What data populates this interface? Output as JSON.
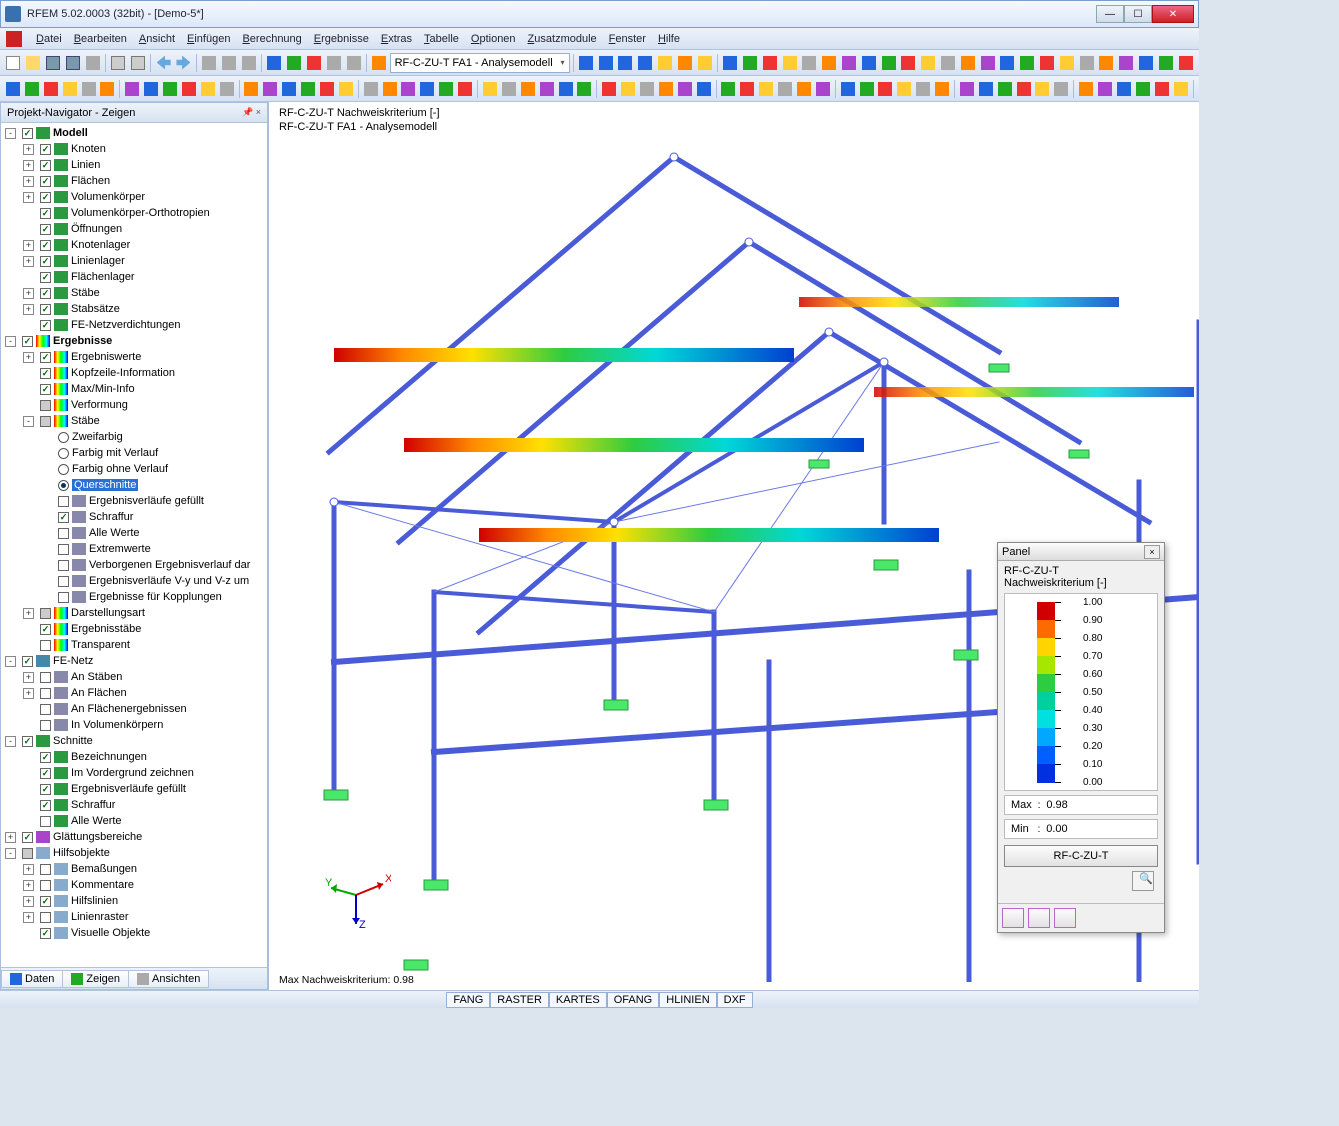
{
  "window": {
    "title": "RFEM 5.02.0003 (32bit) - [Demo-5*]"
  },
  "menu": [
    "Datei",
    "Bearbeiten",
    "Ansicht",
    "Einfügen",
    "Berechnung",
    "Ergebnisse",
    "Extras",
    "Tabelle",
    "Optionen",
    "Zusatzmodule",
    "Fenster",
    "Hilfe"
  ],
  "combo": "RF-C-ZU-T FA1 - Analysemodell",
  "navigator": {
    "title": "Projekt-Navigator - Zeigen",
    "tabs": [
      "Daten",
      "Zeigen",
      "Ansichten"
    ]
  },
  "tree": [
    {
      "d": 0,
      "exp": "-",
      "cb": true,
      "ico": 1,
      "lbl": "Modell",
      "bold": true
    },
    {
      "d": 1,
      "exp": "+",
      "cb": true,
      "ico": 1,
      "lbl": "Knoten"
    },
    {
      "d": 1,
      "exp": "+",
      "cb": true,
      "ico": 1,
      "lbl": "Linien"
    },
    {
      "d": 1,
      "exp": "+",
      "cb": true,
      "ico": 1,
      "lbl": "Flächen"
    },
    {
      "d": 1,
      "exp": "+",
      "cb": true,
      "ico": 1,
      "lbl": "Volumenkörper"
    },
    {
      "d": 1,
      "noexp": true,
      "cb": true,
      "ico": 1,
      "lbl": "Volumenkörper-Orthotropien"
    },
    {
      "d": 1,
      "noexp": true,
      "cb": true,
      "ico": 1,
      "lbl": "Öffnungen"
    },
    {
      "d": 1,
      "exp": "+",
      "cb": true,
      "ico": 1,
      "lbl": "Knotenlager"
    },
    {
      "d": 1,
      "exp": "+",
      "cb": true,
      "ico": 1,
      "lbl": "Linienlager"
    },
    {
      "d": 1,
      "noexp": true,
      "cb": true,
      "ico": 1,
      "lbl": "Flächenlager"
    },
    {
      "d": 1,
      "exp": "+",
      "cb": true,
      "ico": 1,
      "lbl": "Stäbe"
    },
    {
      "d": 1,
      "exp": "+",
      "cb": true,
      "ico": 1,
      "lbl": "Stabsätze"
    },
    {
      "d": 1,
      "noexp": true,
      "cb": true,
      "ico": 1,
      "lbl": "FE-Netzverdichtungen"
    },
    {
      "d": 0,
      "exp": "-",
      "cb": true,
      "ico": 2,
      "lbl": "Ergebnisse",
      "bold": true
    },
    {
      "d": 1,
      "exp": "+",
      "cb": true,
      "ico": 2,
      "lbl": "Ergebniswerte"
    },
    {
      "d": 1,
      "noexp": true,
      "cb": true,
      "ico": 2,
      "lbl": "Kopfzeile-Information"
    },
    {
      "d": 1,
      "noexp": true,
      "cb": true,
      "ico": 2,
      "lbl": "Max/Min-Info"
    },
    {
      "d": 1,
      "noexp": true,
      "cb": false,
      "mixed": true,
      "ico": 2,
      "lbl": "Verformung"
    },
    {
      "d": 1,
      "exp": "-",
      "cb": false,
      "mixed": true,
      "ico": 2,
      "lbl": "Stäbe"
    },
    {
      "d": 2,
      "noexp": true,
      "radio": false,
      "lbl": "Zweifarbig"
    },
    {
      "d": 2,
      "noexp": true,
      "radio": false,
      "lbl": "Farbig mit Verlauf"
    },
    {
      "d": 2,
      "noexp": true,
      "radio": false,
      "lbl": "Farbig ohne Verlauf"
    },
    {
      "d": 2,
      "noexp": true,
      "radio": true,
      "lbl": "Querschnitte",
      "sel": true
    },
    {
      "d": 2,
      "noexp": true,
      "cb": false,
      "ico": 3,
      "lbl": "Ergebnisverläufe gefüllt"
    },
    {
      "d": 2,
      "noexp": true,
      "cb": true,
      "ico": 3,
      "lbl": "Schraffur"
    },
    {
      "d": 2,
      "noexp": true,
      "cb": false,
      "ico": 3,
      "lbl": "Alle Werte"
    },
    {
      "d": 2,
      "noexp": true,
      "cb": false,
      "ico": 3,
      "lbl": "Extremwerte"
    },
    {
      "d": 2,
      "noexp": true,
      "cb": false,
      "ico": 3,
      "lbl": "Verborgenen Ergebnisverlauf dar"
    },
    {
      "d": 2,
      "noexp": true,
      "cb": false,
      "ico": 3,
      "lbl": "Ergebnisverläufe V-y und V-z um"
    },
    {
      "d": 2,
      "noexp": true,
      "cb": false,
      "ico": 3,
      "lbl": "Ergebnisse für Kopplungen"
    },
    {
      "d": 1,
      "exp": "+",
      "cb": false,
      "mixed": true,
      "ico": 2,
      "lbl": "Darstellungsart"
    },
    {
      "d": 1,
      "noexp": true,
      "cb": true,
      "ico": 2,
      "lbl": "Ergebnisstäbe"
    },
    {
      "d": 1,
      "noexp": true,
      "cb": false,
      "ico": 2,
      "lbl": "Transparent"
    },
    {
      "d": 0,
      "exp": "-",
      "cb": true,
      "ico": 4,
      "lbl": "FE-Netz"
    },
    {
      "d": 1,
      "exp": "+",
      "cb": false,
      "ico": 3,
      "lbl": "An Stäben"
    },
    {
      "d": 1,
      "exp": "+",
      "cb": false,
      "ico": 3,
      "lbl": "An Flächen"
    },
    {
      "d": 1,
      "noexp": true,
      "cb": false,
      "ico": 3,
      "lbl": "An Flächenergebnissen"
    },
    {
      "d": 1,
      "noexp": true,
      "cb": false,
      "ico": 3,
      "lbl": "In Volumenkörpern"
    },
    {
      "d": 0,
      "exp": "-",
      "cb": true,
      "ico": 1,
      "lbl": "Schnitte"
    },
    {
      "d": 1,
      "noexp": true,
      "cb": true,
      "ico": 1,
      "lbl": "Bezeichnungen"
    },
    {
      "d": 1,
      "noexp": true,
      "cb": true,
      "ico": 1,
      "lbl": "Im Vordergrund zeichnen"
    },
    {
      "d": 1,
      "noexp": true,
      "cb": true,
      "ico": 1,
      "lbl": "Ergebnisverläufe gefüllt"
    },
    {
      "d": 1,
      "noexp": true,
      "cb": true,
      "ico": 1,
      "lbl": "Schraffur"
    },
    {
      "d": 1,
      "noexp": true,
      "cb": false,
      "ico": 1,
      "lbl": "Alle Werte"
    },
    {
      "d": 0,
      "exp": "+",
      "cb": true,
      "ico": 5,
      "lbl": "Glättungsbereiche"
    },
    {
      "d": 0,
      "exp": "-",
      "cb": false,
      "mixed": true,
      "ico": 6,
      "lbl": "Hilfsobjekte"
    },
    {
      "d": 1,
      "exp": "+",
      "cb": false,
      "ico": 6,
      "lbl": "Bemaßungen"
    },
    {
      "d": 1,
      "exp": "+",
      "cb": false,
      "ico": 6,
      "lbl": "Kommentare"
    },
    {
      "d": 1,
      "exp": "+",
      "cb": true,
      "ico": 6,
      "lbl": "Hilfslinien"
    },
    {
      "d": 1,
      "exp": "+",
      "cb": false,
      "ico": 6,
      "lbl": "Linienraster"
    },
    {
      "d": 1,
      "noexp": true,
      "cb": true,
      "ico": 6,
      "lbl": "Visuelle Objekte"
    }
  ],
  "canvas": {
    "line1": "RF-C-ZU-T Nachweiskriterium [-]",
    "line2": "RF-C-ZU-T FA1 - Analysemodell",
    "footer": "Max Nachweiskriterium: 0.98",
    "axes": [
      "X",
      "Y",
      "Z"
    ]
  },
  "panel": {
    "title": "Panel",
    "sub1": "RF-C-ZU-T",
    "sub2": "Nachweiskriterium [-]",
    "legend": [
      {
        "v": "1.00",
        "c": "#d00000"
      },
      {
        "v": "0.90",
        "c": "#ff6a00"
      },
      {
        "v": "0.80",
        "c": "#ffd400"
      },
      {
        "v": "0.70",
        "c": "#a6e600"
      },
      {
        "v": "0.60",
        "c": "#2ecc40"
      },
      {
        "v": "0.50",
        "c": "#00d0a0"
      },
      {
        "v": "0.40",
        "c": "#00e0e0"
      },
      {
        "v": "0.30",
        "c": "#00a8ff"
      },
      {
        "v": "0.20",
        "c": "#0060ff"
      },
      {
        "v": "0.10",
        "c": "#0030e0"
      },
      {
        "v": "0.00",
        "c": "#000090"
      }
    ],
    "maxlabel": "Max",
    "maxval": "0.98",
    "minlabel": "Min",
    "minval": "0.00",
    "button": "RF-C-ZU-T"
  },
  "status": [
    "FANG",
    "RASTER",
    "KARTES",
    "OFANG",
    "HLINIEN",
    "DXF"
  ]
}
